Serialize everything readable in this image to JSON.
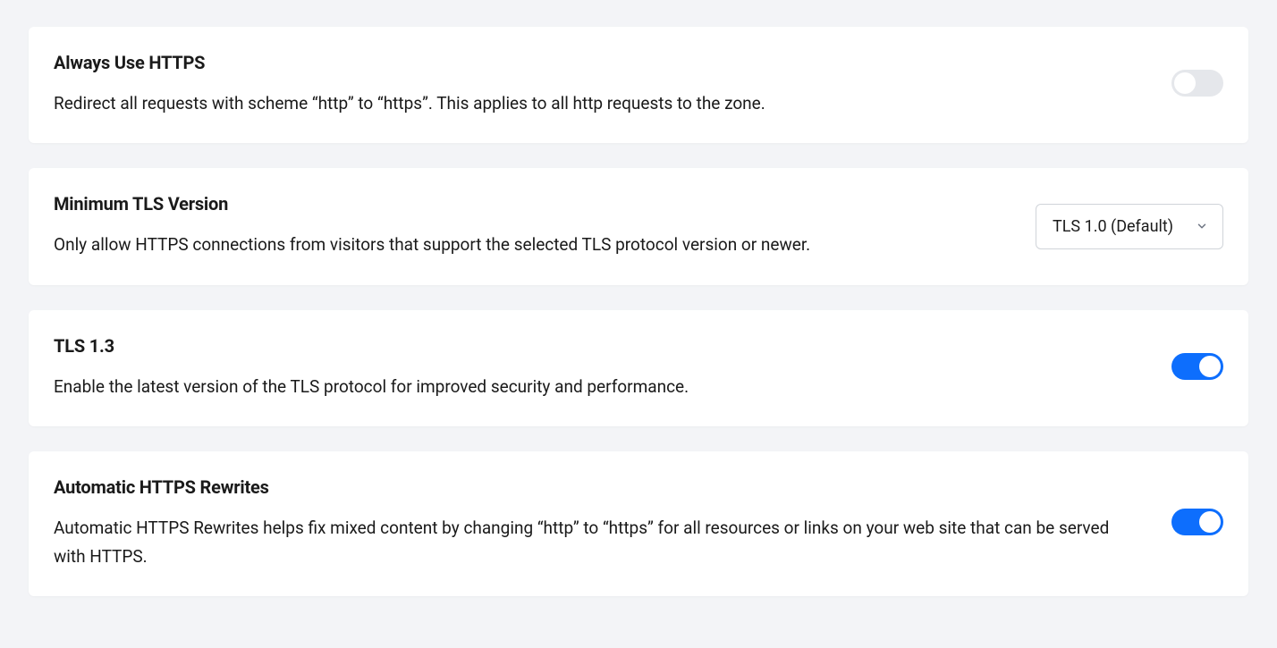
{
  "cards": [
    {
      "title": "Always Use HTTPS",
      "desc": "Redirect all requests with scheme “http” to “https”. This applies to all http requests to the zone.",
      "control": "toggle",
      "enabled": false
    },
    {
      "title": "Minimum TLS Version",
      "desc": "Only allow HTTPS connections from visitors that support the selected TLS protocol version or newer.",
      "control": "select",
      "value": "TLS 1.0 (Default)"
    },
    {
      "title": "TLS 1.3",
      "desc": "Enable the latest version of the TLS protocol for improved security and performance.",
      "control": "toggle",
      "enabled": true
    },
    {
      "title": "Automatic HTTPS Rewrites",
      "desc": "Automatic HTTPS Rewrites helps fix mixed content by changing “http” to “https” for all resources or links on your web site that can be served with HTTPS.",
      "control": "toggle",
      "enabled": true
    }
  ]
}
